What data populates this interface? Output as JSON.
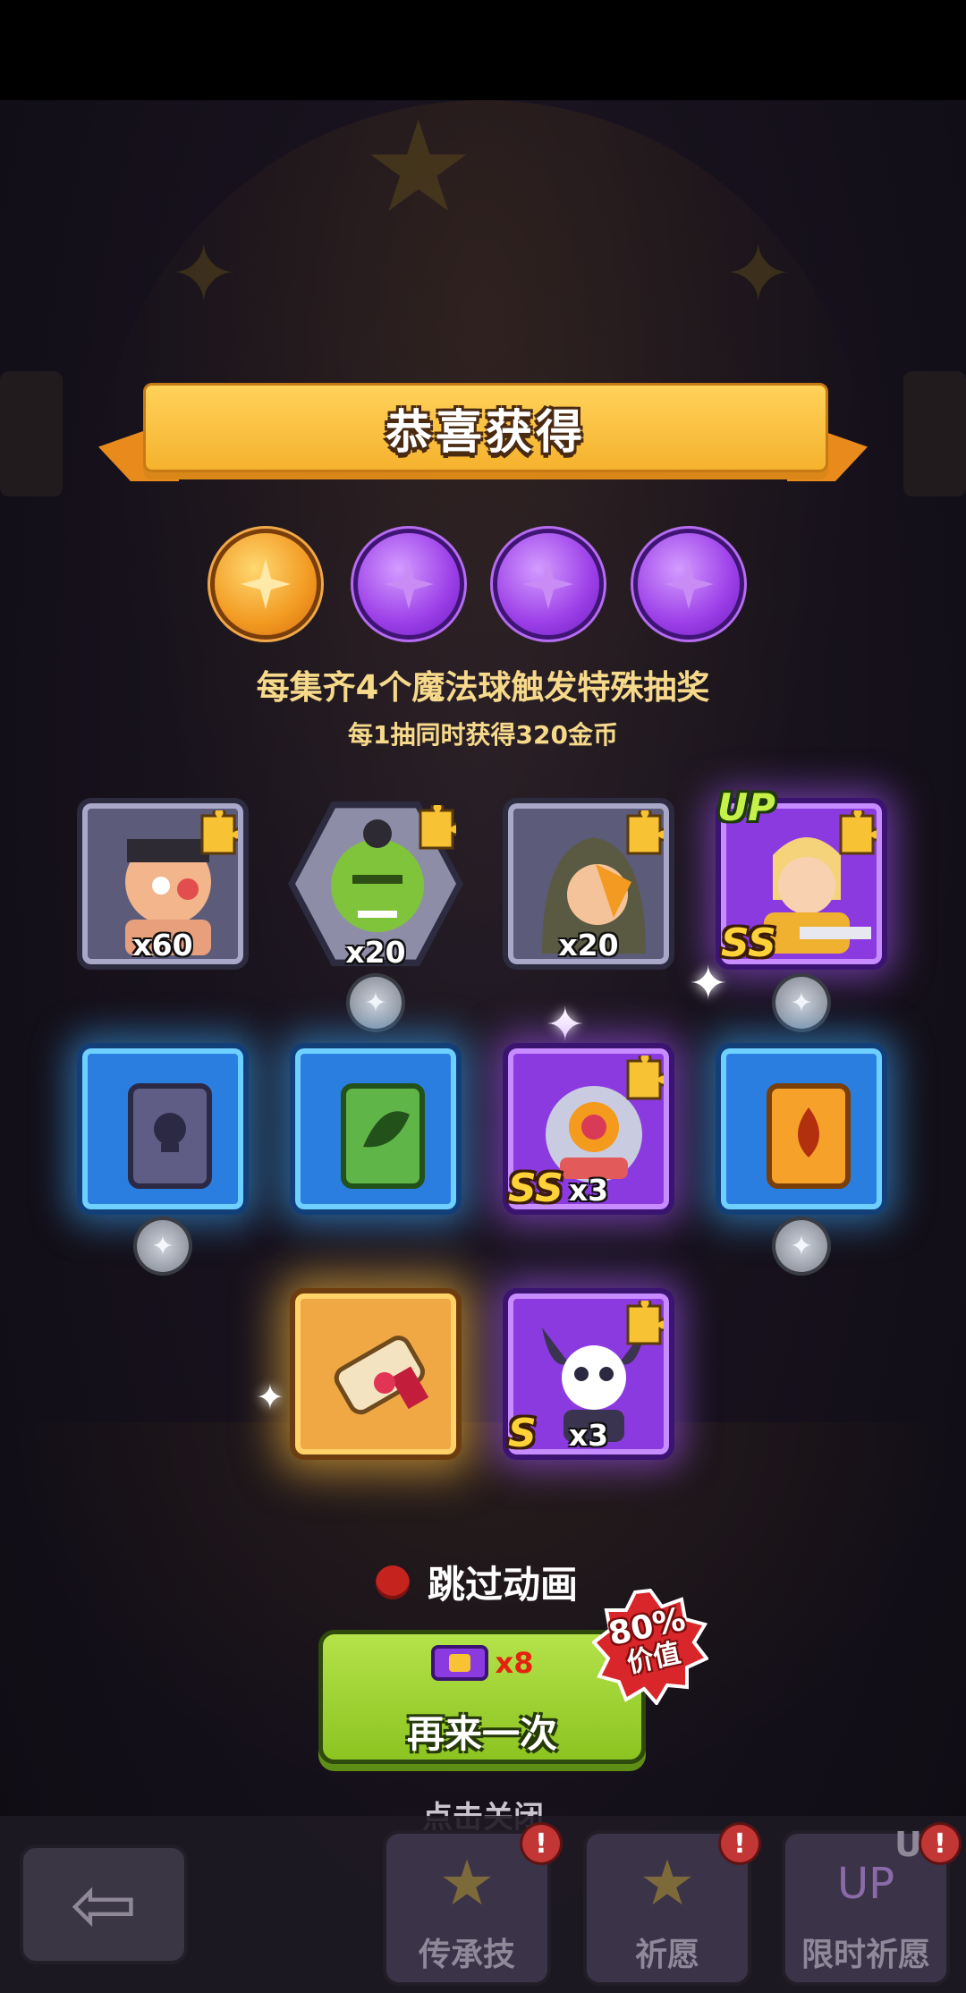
{
  "title": "恭喜获得",
  "orbs": [
    {
      "color": "gold",
      "filled": true
    },
    {
      "color": "purple",
      "filled": true
    },
    {
      "color": "purple",
      "filled": true
    },
    {
      "color": "purple",
      "filled": true
    }
  ],
  "info": {
    "line1": "每集齐4个魔法球触发特殊抽奖",
    "line2": "每1抽同时获得320金币"
  },
  "rewards": [
    {
      "name": "brawler-hero-shards",
      "quantity": "x60",
      "rarity": "",
      "up": "",
      "frame": "grey"
    },
    {
      "name": "orc-hero-shards",
      "quantity": "x20",
      "rarity": "",
      "up": "",
      "frame": "grey-hex"
    },
    {
      "name": "hooded-rogue-shards",
      "quantity": "x20",
      "rarity": "",
      "up": "",
      "frame": "grey"
    },
    {
      "name": "knight-hero-shards",
      "quantity": "",
      "rarity": "SS",
      "up": "UP",
      "frame": "purple"
    },
    {
      "name": "skull-skill-book",
      "quantity": "",
      "rarity": "",
      "up": "",
      "frame": "blue"
    },
    {
      "name": "leaf-skill-book",
      "quantity": "",
      "rarity": "",
      "up": "",
      "frame": "blue"
    },
    {
      "name": "robot-eye-hero-shards",
      "quantity": "x3",
      "rarity": "SS",
      "up": "",
      "frame": "purple"
    },
    {
      "name": "fire-skill-book",
      "quantity": "",
      "rarity": "",
      "up": "",
      "frame": "blue"
    },
    {
      "name": "magic-scroll",
      "quantity": "",
      "rarity": "",
      "up": "",
      "frame": "gold"
    },
    {
      "name": "horned-skull-hero-shards",
      "quantity": "x3",
      "rarity": "S",
      "up": "",
      "frame": "purple"
    }
  ],
  "skip_animation": "跳过动画",
  "again_button": {
    "label": "再来一次",
    "cost_quantity": "x8",
    "cost_icon": "draw-ticket-icon"
  },
  "value_badge": {
    "percent": "80%",
    "label": "价值"
  },
  "close_hint": "点击关闭",
  "bottom_nav": [
    {
      "label": "传承技",
      "icon": "star-shield-icon",
      "alert": "!"
    },
    {
      "label": "祈愿",
      "icon": "star-frame-icon",
      "alert": "!"
    },
    {
      "label": "限时祈愿",
      "icon": "up-frame-icon",
      "alert": "!",
      "tag": "U"
    }
  ],
  "colors": {
    "banner": "#f5b22d",
    "gold_orb": "#f29a22",
    "purple_orb": "#9c3fe8",
    "info_text": "#f6d98a",
    "again_button": "#8cc421",
    "badge": "#d8262a"
  }
}
